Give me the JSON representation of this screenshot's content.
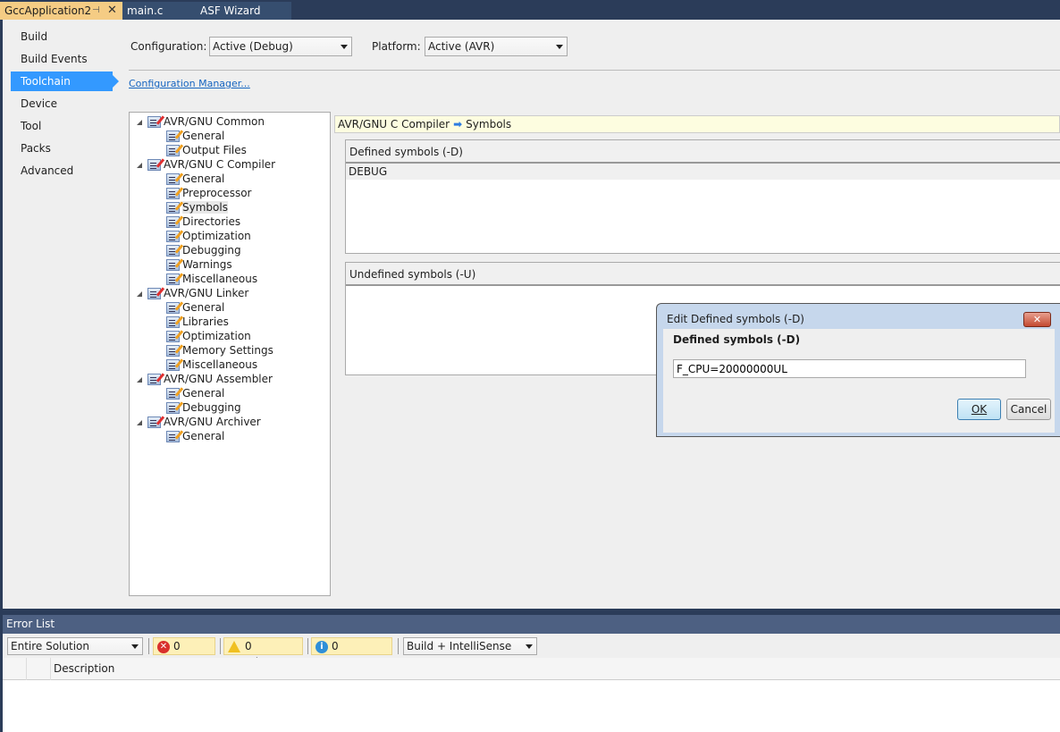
{
  "tabs": [
    {
      "label": "GccApplication2",
      "active": true
    },
    {
      "label": "main.c",
      "active": false
    },
    {
      "label": "ASF Wizard",
      "active": false
    }
  ],
  "sidebar": {
    "items": [
      {
        "label": "Build"
      },
      {
        "label": "Build Events"
      },
      {
        "label": "Toolchain",
        "selected": true
      },
      {
        "label": "Device"
      },
      {
        "label": "Tool"
      },
      {
        "label": "Packs"
      },
      {
        "label": "Advanced"
      }
    ]
  },
  "config": {
    "configuration_label": "Configuration:",
    "configuration_value": "Active (Debug)",
    "platform_label": "Platform:",
    "platform_value": "Active (AVR)",
    "manager_link": "Configuration Manager..."
  },
  "tree": [
    {
      "label": "AVR/GNU Common",
      "level": 0
    },
    {
      "label": "General",
      "level": 1
    },
    {
      "label": "Output Files",
      "level": 1
    },
    {
      "label": "AVR/GNU C Compiler",
      "level": 0
    },
    {
      "label": "General",
      "level": 1
    },
    {
      "label": "Preprocessor",
      "level": 1
    },
    {
      "label": "Symbols",
      "level": 1,
      "selected": true
    },
    {
      "label": "Directories",
      "level": 1
    },
    {
      "label": "Optimization",
      "level": 1
    },
    {
      "label": "Debugging",
      "level": 1
    },
    {
      "label": "Warnings",
      "level": 1
    },
    {
      "label": "Miscellaneous",
      "level": 1
    },
    {
      "label": "AVR/GNU Linker",
      "level": 0
    },
    {
      "label": "General",
      "level": 1
    },
    {
      "label": "Libraries",
      "level": 1
    },
    {
      "label": "Optimization",
      "level": 1
    },
    {
      "label": "Memory Settings",
      "level": 1
    },
    {
      "label": "Miscellaneous",
      "level": 1
    },
    {
      "label": "AVR/GNU Assembler",
      "level": 0
    },
    {
      "label": "General",
      "level": 1
    },
    {
      "label": "Debugging",
      "level": 1
    },
    {
      "label": "AVR/GNU Archiver",
      "level": 0
    },
    {
      "label": "General",
      "level": 1
    }
  ],
  "breadcrumb": {
    "parent": "AVR/GNU C Compiler",
    "arrow": "➡",
    "current": "Symbols"
  },
  "defined": {
    "header": "Defined symbols (-D)",
    "items": [
      "DEBUG"
    ]
  },
  "undefined": {
    "header": "Undefined symbols (-U)",
    "items": []
  },
  "dialog": {
    "title": "Edit Defined symbols (-D)",
    "close": "✕",
    "label": "Defined symbols (-D)",
    "value": "F_CPU=20000000UL",
    "ok": "OK",
    "cancel": "Cancel"
  },
  "error_list": {
    "title": "Error List",
    "scope": "Entire Solution",
    "errors": "0 Errors",
    "warnings": "0 Warnings",
    "messages": "0 Messages",
    "source": "Build + IntelliSense",
    "column_description": "Description"
  }
}
